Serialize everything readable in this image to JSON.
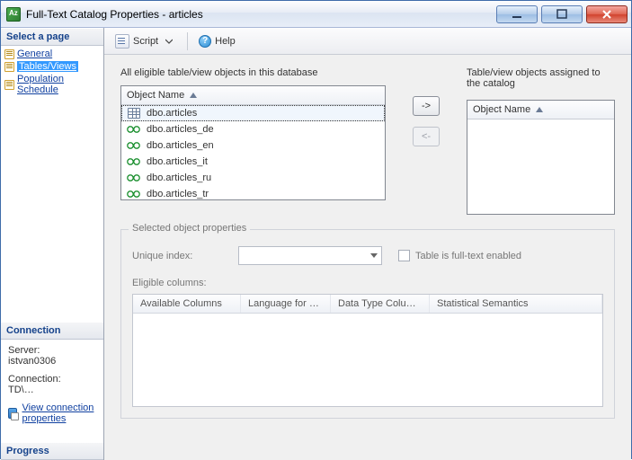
{
  "window": {
    "title": "Full-Text Catalog Properties - articles"
  },
  "sidebar": {
    "select_page": "Select a page",
    "pages": [
      {
        "label": "General"
      },
      {
        "label": "Tables/Views"
      },
      {
        "label": "Population Schedule"
      }
    ],
    "connection": {
      "header": "Connection",
      "server_label": "Server:",
      "server_value": "istvan0306",
      "conn_label": "Connection:",
      "conn_value": "TD\\…",
      "link": "View connection properties"
    },
    "progress": {
      "header": "Progress"
    }
  },
  "toolbar": {
    "script": "Script",
    "help": "Help"
  },
  "main": {
    "eligible_label": "All eligible table/view objects in this database",
    "assigned_label": "Table/view objects assigned to the catalog",
    "col_header": "Object Name",
    "eligible_items": [
      {
        "name": "dbo.articles",
        "type": "table"
      },
      {
        "name": "dbo.articles_de",
        "type": "view"
      },
      {
        "name": "dbo.articles_en",
        "type": "view"
      },
      {
        "name": "dbo.articles_it",
        "type": "view"
      },
      {
        "name": "dbo.articles_ru",
        "type": "view"
      },
      {
        "name": "dbo.articles_tr",
        "type": "view"
      }
    ],
    "btn_right": "->",
    "btn_left": "<-",
    "group_title": "Selected object properties",
    "unique_index": "Unique index:",
    "fulltext_chk": "Table is full-text enabled",
    "eligible_cols": "Eligible columns:",
    "columns": {
      "c1": "Available Columns",
      "c2": "Language for …",
      "c3": "Data Type Colu…",
      "c4": "Statistical Semantics"
    }
  }
}
